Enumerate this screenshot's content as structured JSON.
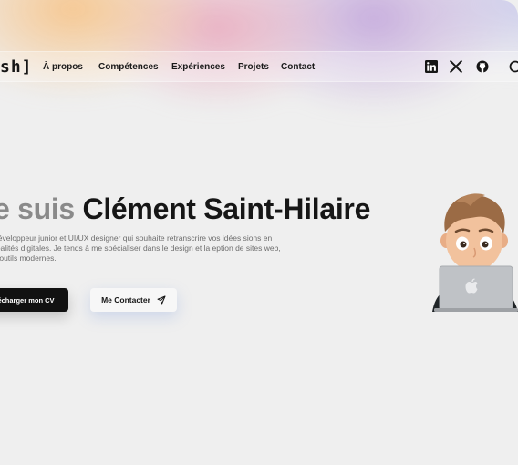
{
  "nav": {
    "logo": "sh]",
    "links": [
      "À propos",
      "Compétences",
      "Expériences",
      "Projets",
      "Contact"
    ],
    "social_icons": [
      "linkedin-icon",
      "x-icon",
      "github-icon"
    ],
    "extra_icon": "search-icon"
  },
  "hero": {
    "title_prefix": "e suis",
    "title_name": "Clément Saint-Hilaire",
    "description": "développeur junior et UI/UX designer qui souhaite retranscrire vos idées sions en réalités digitales. Je tends à me spécialiser dans le design et la eption de sites web, d'outils modernes.",
    "cv_button": "écharger mon CV",
    "contact_button": "Me Contacter",
    "contact_icon": "send-icon"
  },
  "colors": {
    "accent_dark": "#111111",
    "text_dark": "#161616",
    "text_muted": "#8a8a8a",
    "gradient": [
      "#f6c58c",
      "#e8aabe",
      "#c5aadc",
      "#c8c8eb"
    ]
  }
}
